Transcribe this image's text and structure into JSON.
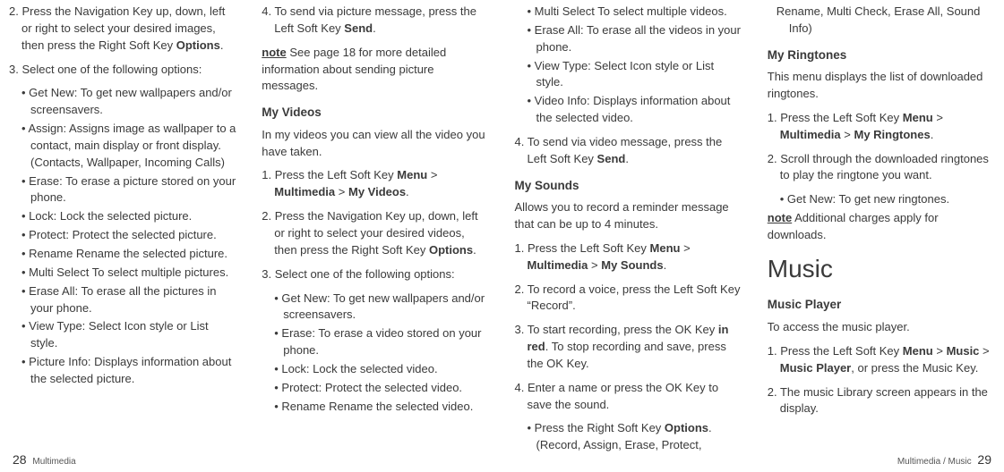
{
  "col1": {
    "step2_pre": "2. Press the Navigation Key up, down, left or right to select your desired images, then press the Right Soft Key ",
    "step2_bold": "Options",
    "step2_post": ".",
    "step3": "3. Select one of the following options:",
    "bullets": [
      "Get New: To get new wallpapers and/or screensavers.",
      "Assign: Assigns image as wallpaper to a contact, main display or front display. (Contacts, Wallpaper, Incoming Calls)",
      "Erase: To erase a picture stored on your phone.",
      "Lock: Lock the selected picture.",
      "Protect: Protect the selected picture.",
      "Rename Rename the selected picture.",
      "Multi Select To select multiple pictures.",
      "Erase All: To erase all the pictures in your phone.",
      "View Type: Select Icon style or List style.",
      "Picture Info: Displays information about the selected picture."
    ]
  },
  "col2": {
    "step4_pre": "4. To send via picture message, press the Left Soft Key ",
    "step4_bold": "Send",
    "step4_post": ".",
    "note_label": "note",
    "note_text": " See page 18 for more detailed information about sending picture messages.",
    "subhead1": "My Videos",
    "intro": "In my videos you can view all the video you have taken.",
    "step1_pre": "1. Press the Left Soft Key ",
    "step1_b1": "Menu",
    "step1_mid": " > ",
    "step1_b2": "Multimedia",
    "step1_mid2": " > ",
    "step1_b3": "My Videos",
    "step1_post": ".",
    "step2_pre": "2. Press the Navigation Key up, down, left or right to select your desired videos, then press the Right Soft Key ",
    "step2_bold": "Options",
    "step2_post": ".",
    "step3": "3. Select one of the following options:",
    "bullets": [
      "Get New: To get new wallpapers and/or screensavers.",
      "Erase: To erase a video stored on your phone.",
      "Lock: Lock the selected video.",
      "Protect: Protect the selected video.",
      "Rename Rename the selected video."
    ]
  },
  "col3": {
    "bullets_top": [
      "Multi Select To select multiple videos.",
      "Erase All: To erase all the videos in your phone.",
      "View Type: Select Icon style or List style.",
      "Video Info: Displays information about the selected video."
    ],
    "step4_pre": "4. To send via video message, press the Left Soft Key ",
    "step4_bold": "Send",
    "step4_post": ".",
    "subhead1": "My Sounds",
    "intro": "Allows you to record a reminder message that can be up to 4 minutes.",
    "step1_pre": "1. Press the Left Soft Key ",
    "step1_b1": "Menu",
    "step1_mid": " > ",
    "step1_b2": "Multimedia",
    "step1_mid2": " > ",
    "step1_b3": "My Sounds",
    "step1_post": ".",
    "step2": "2. To record a voice, press the Left Soft Key “Record”.",
    "step3_pre": "3. To start recording, press the OK Key ",
    "step3_bold": "in red",
    "step3_post": ". To stop recording and save, press the OK Key.",
    "step4b": "4. Enter a name or press the OK Key to save the sound.",
    "sub_bullet_pre": "Press the Right Soft Key ",
    "sub_bullet_bold": "Options",
    "sub_bullet_post": ". (Record, Assign, Erase, Protect,"
  },
  "col4": {
    "cont": "Rename, Multi Check, Erase All, Sound Info)",
    "subhead1": "My Ringtones",
    "intro": "This menu displays the list of downloaded ringtones.",
    "step1_pre": "1. Press the Left Soft Key ",
    "step1_b1": "Menu",
    "step1_mid": " > ",
    "step1_b2": "Multimedia",
    "step1_mid2": " > ",
    "step1_b3": "My Ringtones",
    "step1_post": ".",
    "step2": "2. Scroll through the downloaded ringtones to play the ringtone you want.",
    "bullet1": "Get New: To get new ringtones.",
    "note_label": "note",
    "note_text": " Additional charges apply for downloads.",
    "bighead": "Music",
    "subhead2": "Music Player",
    "intro2": "To access the music player.",
    "mp_step1_pre": "1. Press the Left Soft Key ",
    "mp_step1_b1": "Menu",
    "mp_step1_mid": " > ",
    "mp_step1_b2": "Music",
    "mp_step1_mid2": " > ",
    "mp_step1_b3": "Music Player",
    "mp_step1_post": ", or press the Music Key.",
    "mp_step2": "2. The music Library screen appears in the display."
  },
  "footer": {
    "left_page": "28",
    "left_text": "Multimedia",
    "right_text": "Multimedia / Music",
    "right_page": "29"
  }
}
